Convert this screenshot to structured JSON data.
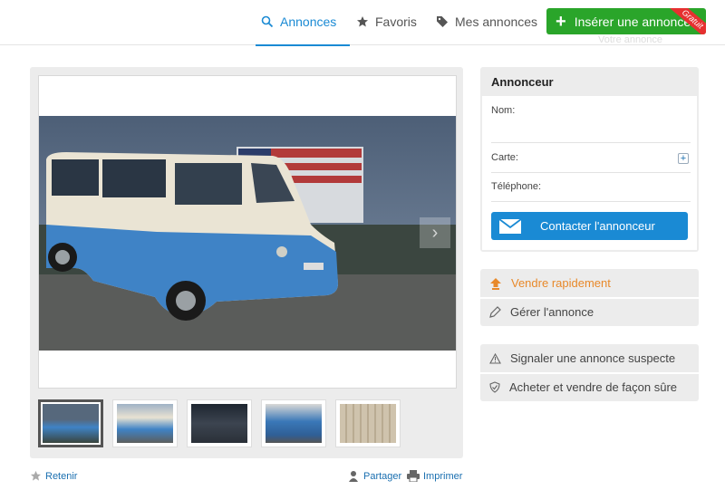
{
  "nav": {
    "annonces": "Annonces",
    "favoris": "Favoris",
    "mes_annonces": "Mes annonces",
    "insert_button": "Insérer une annonce",
    "insert_badge": "Gratuit",
    "faded_subtext": "Votre annonce"
  },
  "gallery": {
    "thumbnail_count": 5,
    "active_thumbnail": 1
  },
  "actions": {
    "retenir": "Retenir",
    "partager": "Partager",
    "imprimer": "Imprimer"
  },
  "annonceur": {
    "title": "Annonceur",
    "nom_label": "Nom:",
    "carte_label": "Carte:",
    "telephone_label": "Téléphone:",
    "contact_button": "Contacter l'annonceur"
  },
  "manage": {
    "vendre": "Vendre rapidement",
    "gerer": "Gérer l'annonce"
  },
  "safety": {
    "signaler": "Signaler une annonce suspecte",
    "acheter": "Acheter et vendre de façon sûre"
  },
  "colors": {
    "accent_blue": "#1a8ad4",
    "insert_green": "#2aa52a",
    "badge_red": "#e63030",
    "vendre_orange": "#e8892a"
  }
}
